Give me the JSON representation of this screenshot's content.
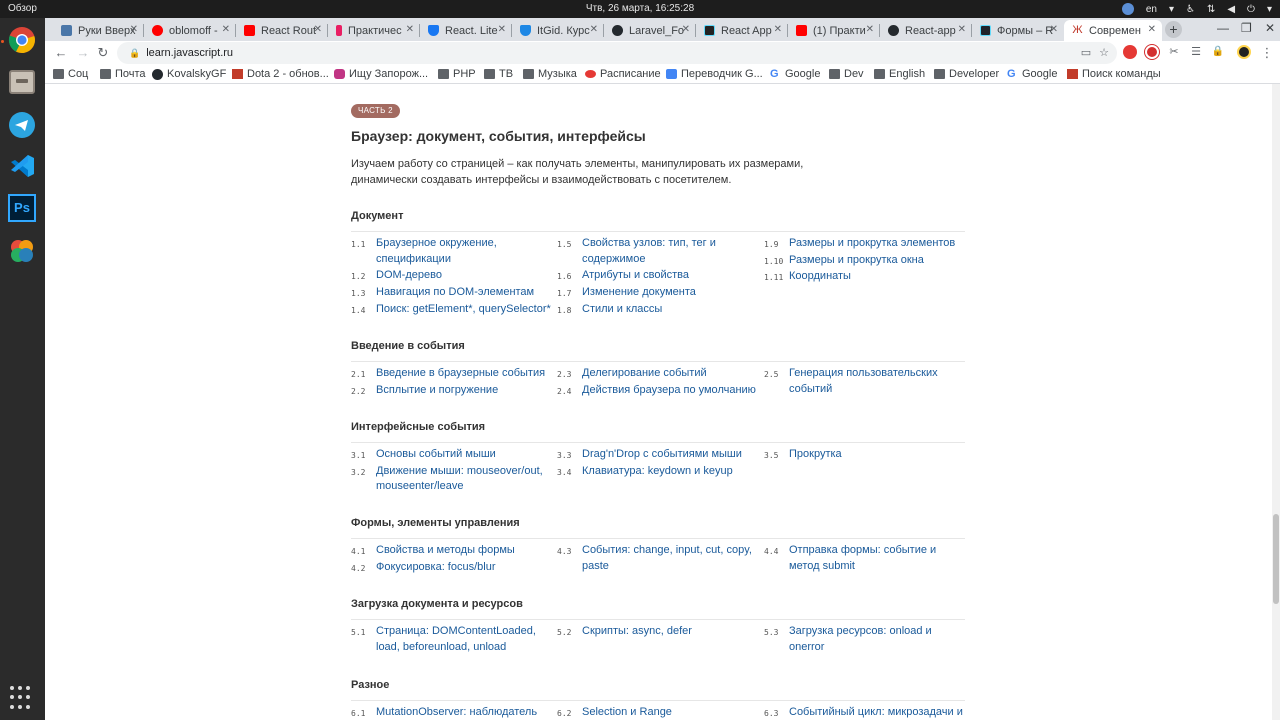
{
  "system": {
    "overview": "Обзор",
    "clock": "Чтв, 26 марта, 16:25:28",
    "lang": "en"
  },
  "browser": {
    "tabs": [
      {
        "title": "Руки Вверх",
        "color": "#4a76a8"
      },
      {
        "title": "oblomoff -",
        "color": "#ff0000"
      },
      {
        "title": "React Rout",
        "color": "#ff0000"
      },
      {
        "title": "Практичес",
        "color": "#e91e63"
      },
      {
        "title": "React. Lite",
        "color": "#1877f2"
      },
      {
        "title": "ItGid. Курс",
        "color": "#1e88e5"
      },
      {
        "title": "Laravel_Fo",
        "color": "#24292e"
      },
      {
        "title": "React App",
        "color": "#222222"
      },
      {
        "title": "(1) Практи",
        "color": "#ff0000"
      },
      {
        "title": "React-app",
        "color": "#24292e"
      },
      {
        "title": "Формы – R",
        "color": "#20232a"
      },
      {
        "title": "Современ",
        "color": "#c0392b"
      }
    ],
    "url": "learn.javascript.ru",
    "bookmarks": [
      {
        "label": "Соц",
        "icon": "folder-icon"
      },
      {
        "label": "Почта",
        "icon": "folder-icon"
      },
      {
        "label": "KovalskyGF",
        "icon": "github-icon"
      },
      {
        "label": "Dota 2 - обнов...",
        "icon": "dota-icon"
      },
      {
        "label": "Ищу Запорож...",
        "icon": "instagram-icon"
      },
      {
        "label": "PHP",
        "icon": "folder-icon"
      },
      {
        "label": "ТВ",
        "icon": "folder-icon"
      },
      {
        "label": "Музыка",
        "icon": "folder-icon"
      },
      {
        "label": "Расписание",
        "icon": "schedule-icon"
      },
      {
        "label": "Переводчик G...",
        "icon": "translate-icon"
      },
      {
        "label": "Google",
        "icon": "google-icon"
      },
      {
        "label": "Dev",
        "icon": "folder-icon"
      },
      {
        "label": "English",
        "icon": "folder-icon"
      },
      {
        "label": "Developer",
        "icon": "folder-icon"
      },
      {
        "label": "Google",
        "icon": "google-icon"
      },
      {
        "label": "Поиск команды",
        "icon": "dota-icon"
      }
    ]
  },
  "page": {
    "badge": "ЧАСТЬ 2",
    "title": "Браузер: документ, события, интерфейсы",
    "description": "Изучаем работу со страницей – как получать элементы, манипулировать их размерами, динамически создавать интерфейсы и взаимодействовать с посетителем.",
    "sections": [
      {
        "title": "Документ",
        "columns": [
          [
            {
              "num": "1.1",
              "text": "Браузерное окружение, спецификации"
            },
            {
              "num": "1.2",
              "text": "DOM-дерево"
            },
            {
              "num": "1.3",
              "text": "Навигация по DOM-элементам"
            },
            {
              "num": "1.4",
              "text": "Поиск: getElement*, querySelector*"
            }
          ],
          [
            {
              "num": "1.5",
              "text": "Свойства узлов: тип, тег и содержимое"
            },
            {
              "num": "1.6",
              "text": "Атрибуты и свойства"
            },
            {
              "num": "1.7",
              "text": "Изменение документа"
            },
            {
              "num": "1.8",
              "text": "Стили и классы"
            }
          ],
          [
            {
              "num": "1.9",
              "text": "Размеры и прокрутка элементов"
            },
            {
              "num": "1.10",
              "text": "Размеры и прокрутка окна"
            },
            {
              "num": "1.11",
              "text": "Координаты"
            }
          ]
        ]
      },
      {
        "title": "Введение в события",
        "columns": [
          [
            {
              "num": "2.1",
              "text": "Введение в браузерные события"
            },
            {
              "num": "2.2",
              "text": "Всплытие и погружение"
            }
          ],
          [
            {
              "num": "2.3",
              "text": "Делегирование событий"
            },
            {
              "num": "2.4",
              "text": "Действия браузера по умолчанию"
            }
          ],
          [
            {
              "num": "2.5",
              "text": "Генерация пользовательских событий"
            }
          ]
        ]
      },
      {
        "title": "Интерфейсные события",
        "columns": [
          [
            {
              "num": "3.1",
              "text": "Основы событий мыши"
            },
            {
              "num": "3.2",
              "text": "Движение мыши: mouseover/out, mouseenter/leave"
            }
          ],
          [
            {
              "num": "3.3",
              "text": "Drag'n'Drop с событиями мыши"
            },
            {
              "num": "3.4",
              "text": "Клавиатура: keydown и keyup"
            }
          ],
          [
            {
              "num": "3.5",
              "text": "Прокрутка"
            }
          ]
        ]
      },
      {
        "title": "Формы, элементы управления",
        "columns": [
          [
            {
              "num": "4.1",
              "text": "Свойства и методы формы"
            },
            {
              "num": "4.2",
              "text": "Фокусировка: focus/blur"
            }
          ],
          [
            {
              "num": "4.3",
              "text": "События: change, input, cut, copy, paste"
            }
          ],
          [
            {
              "num": "4.4",
              "text": "Отправка формы: событие и метод submit"
            }
          ]
        ]
      },
      {
        "title": "Загрузка документа и ресурсов",
        "columns": [
          [
            {
              "num": "5.1",
              "text": "Страница: DOMContentLoaded, load, beforeunload, unload"
            }
          ],
          [
            {
              "num": "5.2",
              "text": "Скрипты: async, defer"
            }
          ],
          [
            {
              "num": "5.3",
              "text": "Загрузка ресурсов: onload и onerror"
            }
          ]
        ]
      },
      {
        "title": "Разное",
        "columns": [
          [
            {
              "num": "6.1",
              "text": "MutationObserver: наблюдатель за"
            }
          ],
          [
            {
              "num": "6.2",
              "text": "Selection и Range"
            }
          ],
          [
            {
              "num": "6.3",
              "text": "Событийный цикл: микрозадачи и"
            }
          ]
        ]
      }
    ]
  }
}
